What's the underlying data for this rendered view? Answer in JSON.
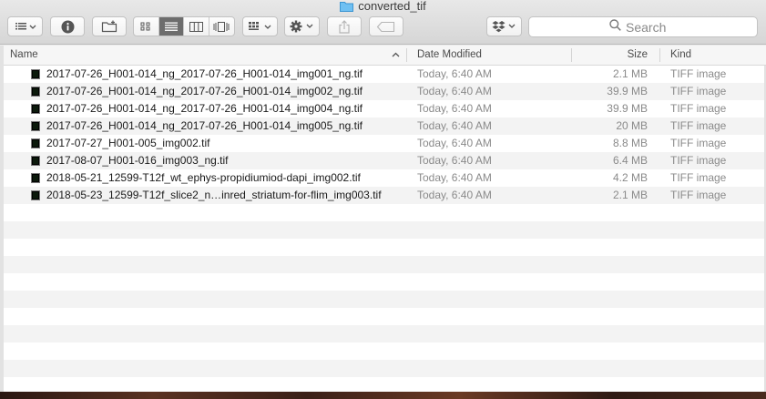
{
  "window": {
    "title": "converted_tif"
  },
  "toolbar": {
    "icons": [
      "view-options-icon",
      "info-icon",
      "new-folder-icon",
      "icon-view-icon",
      "list-view-icon",
      "column-view-icon",
      "cover-flow-icon",
      "arrange-icon",
      "action-gear-icon",
      "share-icon",
      "tag-icon",
      "dropbox-icon"
    ],
    "active_view": "list"
  },
  "search": {
    "placeholder": "Search"
  },
  "columns": {
    "name": "Name",
    "date": "Date Modified",
    "size": "Size",
    "kind": "Kind",
    "sort_indicator": "^"
  },
  "files": [
    {
      "name": "2017-07-26_H001-014_ng_2017-07-26_H001-014_img001_ng.tif",
      "date": "Today, 6:40 AM",
      "size": "2.1 MB",
      "kind": "TIFF image"
    },
    {
      "name": "2017-07-26_H001-014_ng_2017-07-26_H001-014_img002_ng.tif",
      "date": "Today, 6:40 AM",
      "size": "39.9 MB",
      "kind": "TIFF image"
    },
    {
      "name": "2017-07-26_H001-014_ng_2017-07-26_H001-014_img004_ng.tif",
      "date": "Today, 6:40 AM",
      "size": "39.9 MB",
      "kind": "TIFF image"
    },
    {
      "name": "2017-07-26_H001-014_ng_2017-07-26_H001-014_img005_ng.tif",
      "date": "Today, 6:40 AM",
      "size": "20 MB",
      "kind": "TIFF image"
    },
    {
      "name": "2017-07-27_H001-005_img002.tif",
      "date": "Today, 6:40 AM",
      "size": "8.8 MB",
      "kind": "TIFF image"
    },
    {
      "name": "2017-08-07_H001-016_img003_ng.tif",
      "date": "Today, 6:40 AM",
      "size": "6.4 MB",
      "kind": "TIFF image"
    },
    {
      "name": "2018-05-21_12599-T12f_wt_ephys-propidiumiod-dapi_img002.tif",
      "date": "Today, 6:40 AM",
      "size": "4.2 MB",
      "kind": "TIFF image"
    },
    {
      "name": "2018-05-23_12599-T12f_slice2_n…inred_striatum-for-flim_img003.tif",
      "date": "Today, 6:40 AM",
      "size": "2.1 MB",
      "kind": "TIFF image"
    }
  ],
  "colors": {
    "folder_blue": "#5fb2ea",
    "active_segment": "#6d6d6d"
  }
}
